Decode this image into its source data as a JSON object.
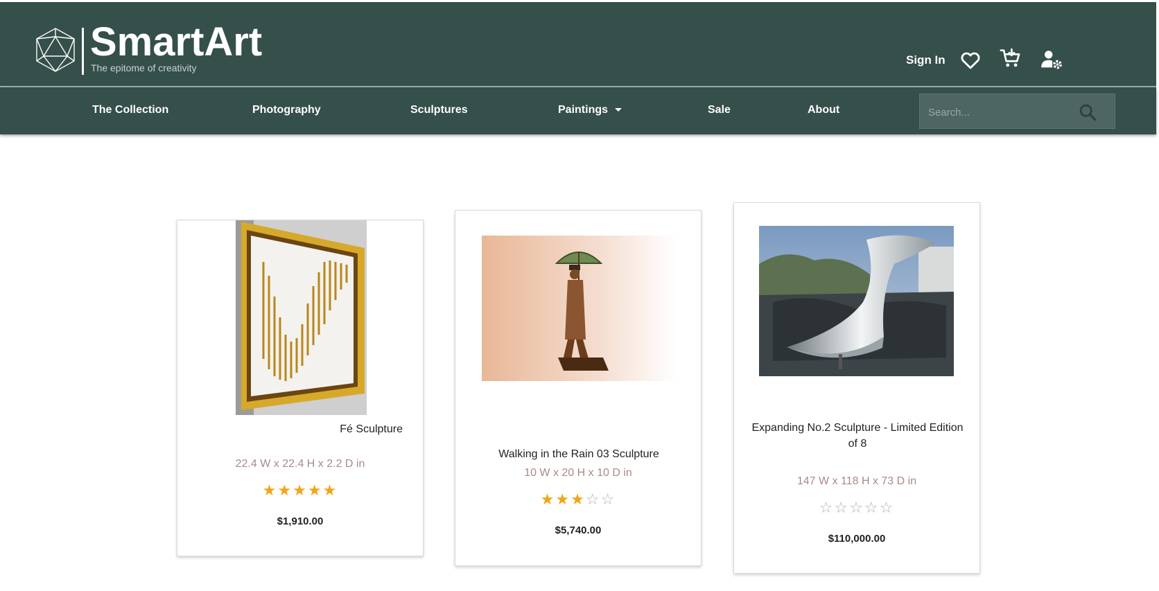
{
  "brand": {
    "name": "SmartArt",
    "tagline": "The epitome of creativity"
  },
  "header": {
    "signin_label": "Sign In",
    "icons": [
      "heart-icon",
      "cart-icon",
      "user-settings-icon"
    ]
  },
  "nav": {
    "items": [
      {
        "label": "The Collection"
      },
      {
        "label": "Photography"
      },
      {
        "label": "Sculptures"
      },
      {
        "label": "Paintings"
      },
      {
        "label": "Sale"
      },
      {
        "label": "About"
      }
    ],
    "search_placeholder": "Search..."
  },
  "colors": {
    "header_bg": "#354f4b",
    "star": "#f2a516",
    "dims": "#a88a86"
  },
  "products": [
    {
      "title": "Fé Sculpture",
      "dims": "22.4 W x 22.4 H x 2.2 D in",
      "rating": 5,
      "price": "$1,910.00"
    },
    {
      "title": "Walking in the Rain 03 Sculpture",
      "dims": "10 W x 20 H x 10 D in",
      "rating": 3,
      "price": "$5,740.00"
    },
    {
      "title": "Expanding No.2 Sculpture - Limited Edition of 8",
      "dims": "147 W x 118 H x 73 D in",
      "rating": 0,
      "price": "$110,000.00"
    }
  ]
}
